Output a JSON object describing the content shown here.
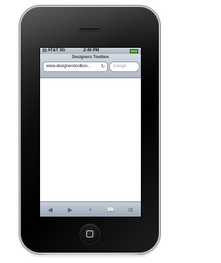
{
  "status_bar": {
    "carrier": "AT&T 3G",
    "time": "2:40 PM"
  },
  "nav_bar": {
    "title": "Designers Toolbox",
    "url": "www.designerstoolbox...",
    "search_placeholder": "Google"
  },
  "toolbar": {
    "back": "◀",
    "forward": "▶",
    "add": "+",
    "bookmarks": "📖",
    "pages": "⧉"
  },
  "icons": {
    "reload": "reload-icon",
    "battery": "battery-icon",
    "signal": "signal-icon",
    "home": "home-button-icon"
  }
}
